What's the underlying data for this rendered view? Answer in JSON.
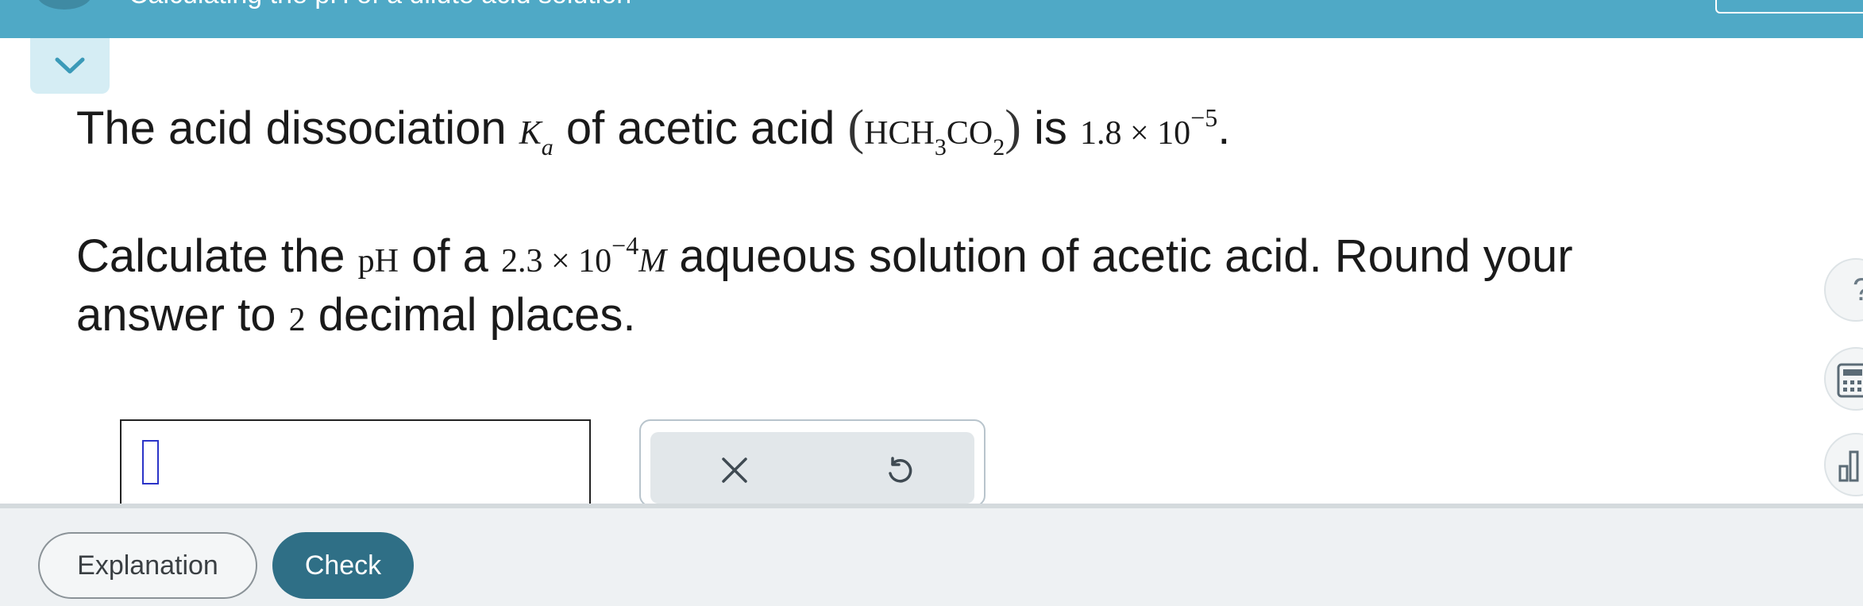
{
  "header": {
    "title": "Calculating the pH of a dilute acid solution"
  },
  "question": {
    "line1": {
      "t1": "The acid dissociation ",
      "ka_k": "K",
      "ka_a": "a",
      "t2": " of acetic acid ",
      "paren_open": "(",
      "f1": "HCH",
      "f_sub3": "3",
      "f2": "CO",
      "f_sub2": "2",
      "paren_close": ")",
      "t3": " is ",
      "ka_coeff": "1.8 × 10",
      "ka_exp": "−5",
      "period": "."
    },
    "line2": {
      "t1": "Calculate the ",
      "ph": "pH",
      "t2": " of a ",
      "conc_coeff": "2.3 × 10",
      "conc_exp": "−4",
      "conc_unit": "M",
      "t3": " aqueous solution of acetic acid. Round your"
    },
    "line3": {
      "t1": "answer to ",
      "digits": "2",
      "t2": " decimal places."
    }
  },
  "answer": {
    "value": ""
  },
  "tools": {
    "clear_icon": "x-icon",
    "undo_icon": "undo-icon"
  },
  "side": {
    "help_glyph": "?"
  },
  "footer": {
    "explanation_label": "Explanation",
    "check_label": "Check"
  },
  "colors": {
    "header": "#4fa9c6",
    "check": "#2f6f86",
    "cursor": "#2b34c8"
  }
}
